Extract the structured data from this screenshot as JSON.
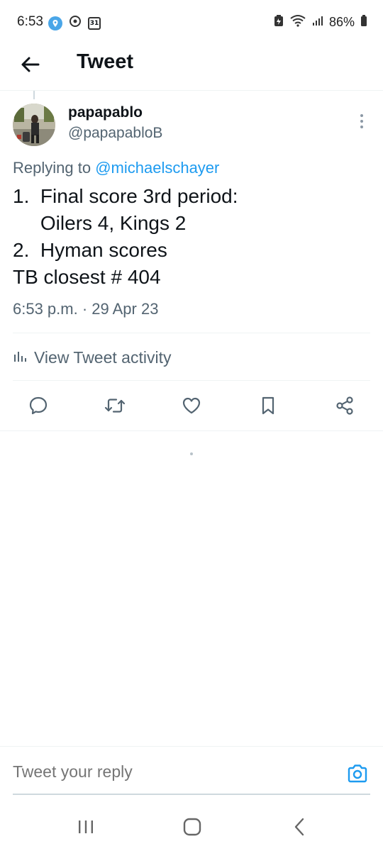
{
  "status_bar": {
    "time": "6:53",
    "calendar_day": "31",
    "battery": "86%",
    "icons_left": [
      "location-icon",
      "sync-icon",
      "calendar-icon"
    ],
    "icons_right": [
      "battery-saver-icon",
      "wifi-icon",
      "signal-icon",
      "battery-icon"
    ]
  },
  "header": {
    "title": "Tweet",
    "back_icon": "arrow-left-icon"
  },
  "tweet": {
    "display_name": "papapablo",
    "handle": "@papapabloB",
    "replying_prefix": "Replying to ",
    "replying_to": "@michaelschayer",
    "text": "1.  Final score 3rd period:\n     Oilers 4, Kings 2\n2.  Hyman scores\nTB closest # 404",
    "timestamp": "6:53 p.m. · 29 Apr 23"
  },
  "activity": {
    "label": "View Tweet activity",
    "icon": "bar-chart-icon"
  },
  "actions": [
    "reply-icon",
    "retweet-icon",
    "like-icon",
    "bookmark-icon",
    "share-icon"
  ],
  "reply_bar": {
    "placeholder": "Tweet your reply",
    "icon": "camera-icon"
  },
  "nav_bar": {
    "buttons": [
      "recents-icon",
      "home-icon",
      "back-icon"
    ]
  },
  "colors": {
    "accent": "#1d9bf0",
    "text_primary": "#0f1419",
    "text_secondary": "#536471",
    "divider": "#eff3f4"
  }
}
